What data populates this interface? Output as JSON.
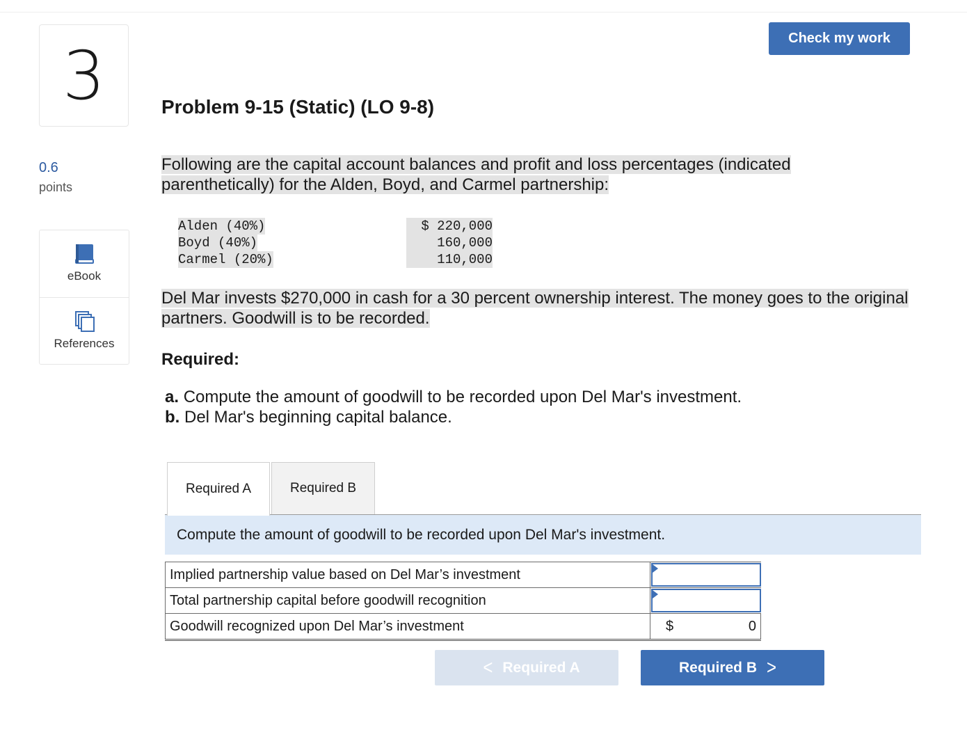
{
  "question": {
    "number": "3",
    "points_value": "0.6",
    "points_label": "points"
  },
  "tools": {
    "ebook_label": "eBook",
    "references_label": "References"
  },
  "header": {
    "check_button": "Check my work",
    "title": "Problem 9-15 (Static) (LO 9-8)"
  },
  "problem": {
    "intro": "Following are the capital account balances and profit and loss percentages (indicated parenthetically) for the Alden, Boyd, and Carmel partnership:",
    "accounts": [
      {
        "name": "Alden (40%)",
        "value": "$ 220,000"
      },
      {
        "name": "Boyd (40%)",
        "value": "160,000"
      },
      {
        "name": "Carmel (20%)",
        "value": "110,000"
      }
    ],
    "scenario": "Del Mar invests $270,000 in cash for a 30 percent ownership interest. The money goes to the original partners. Goodwill is to be recorded.",
    "required_heading": "Required:",
    "requirements": [
      {
        "letter": "a.",
        "text": "Compute the amount of goodwill to be recorded upon Del Mar's investment."
      },
      {
        "letter": "b.",
        "text": "Del Mar's beginning capital balance."
      }
    ]
  },
  "tabs": [
    {
      "label": "Required A"
    },
    {
      "label": "Required B"
    }
  ],
  "instruction": "Compute the amount of goodwill to be recorded upon Del Mar's investment.",
  "answer_table": {
    "rows": [
      {
        "label": "Implied partnership value based on Del Mar’s investment",
        "value": ""
      },
      {
        "label": "Total partnership capital before goodwill recognition",
        "value": ""
      },
      {
        "label": "Goodwill recognized upon Del Mar’s investment",
        "currency": "$",
        "value": "0"
      }
    ]
  },
  "navigation": {
    "prev_label": "Required A",
    "next_label": "Required B",
    "prev_chevron": "<",
    "next_chevron": ">"
  },
  "colors": {
    "accent": "#3d6fb5",
    "instruction_bg": "#dde9f7",
    "disabled_button": "#dae3ef",
    "highlight": "#e3e3e3"
  }
}
